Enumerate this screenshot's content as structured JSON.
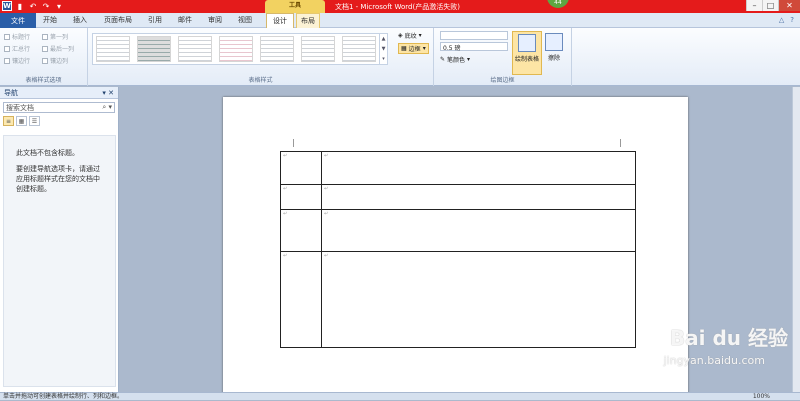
{
  "title": {
    "text": "文档1 - Microsoft Word(产品激活失败)",
    "context_label": "工具",
    "badge": "44"
  },
  "qat": {
    "word": "W",
    "save": "▮",
    "undo": "↶",
    "redo": "↷",
    "more": "▾"
  },
  "window_controls": {
    "min": "–",
    "max": "□",
    "close": "✕"
  },
  "tabs": {
    "file": "文件",
    "items": [
      "开始",
      "插入",
      "页面布局",
      "引用",
      "邮件",
      "审阅",
      "视图"
    ],
    "design": "设计",
    "layout": "布局"
  },
  "ribbon_right": {
    "minimize": "△",
    "help": "?"
  },
  "table_style_options": {
    "items": [
      "标题行",
      "第一列",
      "汇总行",
      "最后一列",
      "镶边行",
      "镶边列"
    ],
    "label": "表格样式选项"
  },
  "table_styles": {
    "label": "表格样式"
  },
  "borders_group": {
    "shading": "底纹",
    "borders": "边框",
    "weight": "0.5 磅",
    "pen_color": "笔颜色",
    "draw_table": "绘制表格",
    "eraser": "擦除",
    "label": "绘图边框"
  },
  "nav": {
    "title": "导航",
    "search_placeholder": "搜索文档",
    "msg1": "此文档不包含标题。",
    "msg2": "要创建导航选项卡，请通过应用标题样式在您的文档中创建标题。"
  },
  "status": {
    "left": "单击并拖动可创建表格并绘制行、列和边框。",
    "zoom": "100%"
  },
  "watermark": {
    "logo": "Bai du 经验",
    "url": "jingyan.baidu.com"
  },
  "para_mark": "↵"
}
